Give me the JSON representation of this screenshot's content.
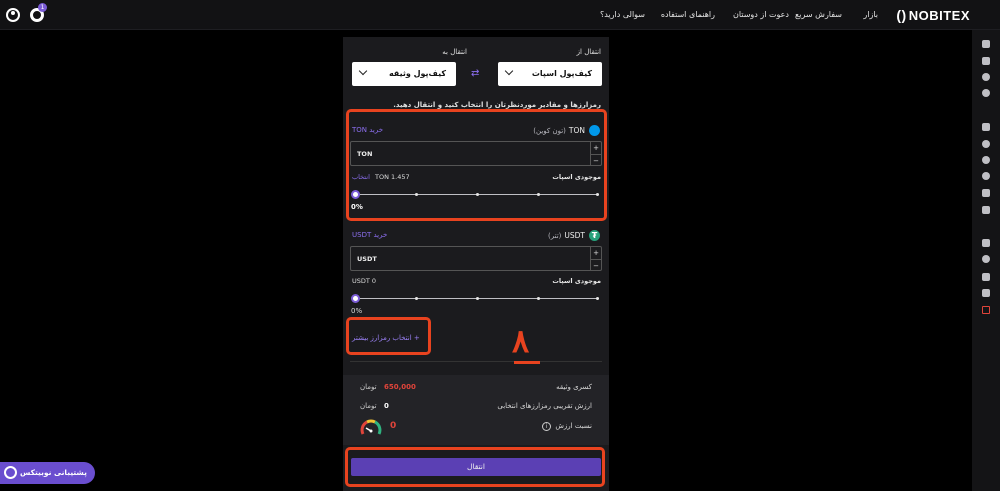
{
  "header": {
    "logo": "NOBITEX",
    "nav": [
      "بازار",
      "سفارش سریع",
      "دعوت از دوستان",
      "راهنمای استفاده",
      "سوالی دارید؟"
    ],
    "notification_count": "1"
  },
  "transfer": {
    "from_label": "انتقال از",
    "to_label": "انتقال به",
    "from_wallet": "کیف‌پول اسپات",
    "to_wallet": "کیف‌پول وثیقه",
    "instruction": "رمزارزها و مقادیر موردنظرتان را انتخاب کنید و انتقال دهید."
  },
  "assets": [
    {
      "symbol": "TON",
      "name": "(تون کوین)",
      "buy_label": "خرید TON",
      "unit": "TON",
      "balance_label": "موجودی اسپات",
      "balance": "TON 1.457",
      "select_all": "انتخاب",
      "percent": "0%"
    },
    {
      "symbol": "USDT",
      "name": "(تتر)",
      "buy_label": "خرید USDT",
      "unit": "USDT",
      "balance_label": "موجودی اسپات",
      "balance": "USDT 0",
      "percent": "0%"
    }
  ],
  "more_button": "+ انتخاب رمزارز بیشتر",
  "summary": {
    "deficit_label": "کسری وثیقه",
    "deficit_value": "650,000",
    "deficit_unit": "تومان",
    "approx_label": "ارزش تقریبی رمزارزهای انتخابی",
    "approx_value": "0",
    "approx_unit": "تومان",
    "ratio_label": "نسبت ارزش",
    "ratio_value": "0",
    "info_glyph": "i"
  },
  "submit_label": "انتقال",
  "support_label": "پشتیبانی نوبیتکس",
  "annotation": "۸",
  "colors": {
    "accent": "#7b5cd6",
    "highlight": "#e8431f",
    "danger": "#e0443a",
    "panel": "#1b1b1e"
  }
}
